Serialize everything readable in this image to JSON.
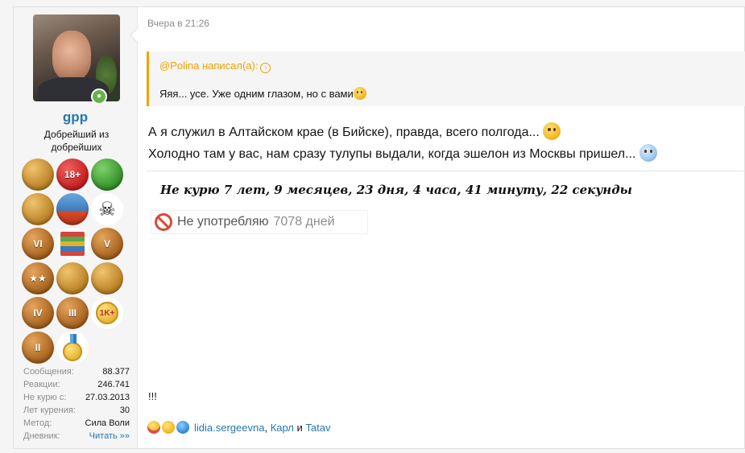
{
  "user": {
    "name": "gpp",
    "title": "Добрейший из добрейших",
    "stats": [
      {
        "key": "Сообщения:",
        "value": "88.377"
      },
      {
        "key": "Реакции:",
        "value": "246.741"
      },
      {
        "key": "Не курю с:",
        "value": "27.03.2013"
      },
      {
        "key": "Лет курения:",
        "value": "30"
      },
      {
        "key": "Метод:",
        "value": "Сила Воли"
      },
      {
        "key": "Дневник:",
        "value": "Читать »»"
      }
    ],
    "trophies": [
      {
        "icon": "gold-star-trophy-icon",
        "label": ""
      },
      {
        "icon": "no-smoking-18-icon",
        "label": "18+"
      },
      {
        "icon": "ambulance-icon",
        "label": ""
      },
      {
        "icon": "gold-star-trophy-icon",
        "label": ""
      },
      {
        "icon": "mountain-fuji-icon",
        "label": ""
      },
      {
        "icon": "skull-badge-icon",
        "label": "☠"
      },
      {
        "icon": "mountain-level-icon",
        "label": "VI"
      },
      {
        "icon": "books-icon",
        "label": ""
      },
      {
        "icon": "mountain-level-icon",
        "label": "V"
      },
      {
        "icon": "mountain-stars-icon",
        "label": "★★"
      },
      {
        "icon": "open-book-icon",
        "label": ""
      },
      {
        "icon": "people-circle-icon",
        "label": ""
      },
      {
        "icon": "mountain-level-icon",
        "label": "IV"
      },
      {
        "icon": "mountain-level-icon",
        "label": "III"
      },
      {
        "icon": "medal-1k-icon",
        "label": "1K+"
      },
      {
        "icon": "mountain-level-icon",
        "label": "II"
      },
      {
        "icon": "medal-flag-icon",
        "label": ""
      }
    ]
  },
  "post": {
    "date": "Вчера в 21:26",
    "quote_author": "@Polina написал(а):",
    "quote_text": "Яяя... усе. Уже одним глазом, но с вами",
    "line1": "А я служил в Алтайском крае (в Бийске), правда, всего полгода...",
    "line2": "Холодно там у вас, нам сразу тулупы выдали, когда эшелон из Москвы пришел...",
    "signature_line1": "Не курю  7 лет, 9 месяцев, 23 дня, 4 часа, 41 минуту, 22 секунды",
    "signature_label": "Не употребляю",
    "signature_days": "7078 дней",
    "extra": "!!!"
  },
  "reactions": {
    "icons": [
      "love-reaction-icon",
      "wow-reaction-icon",
      "like-reaction-icon"
    ],
    "user1": "lidia.sergeevna",
    "sep": ", ",
    "user2": "Карл",
    "and": " и ",
    "user3": "Tatav"
  }
}
